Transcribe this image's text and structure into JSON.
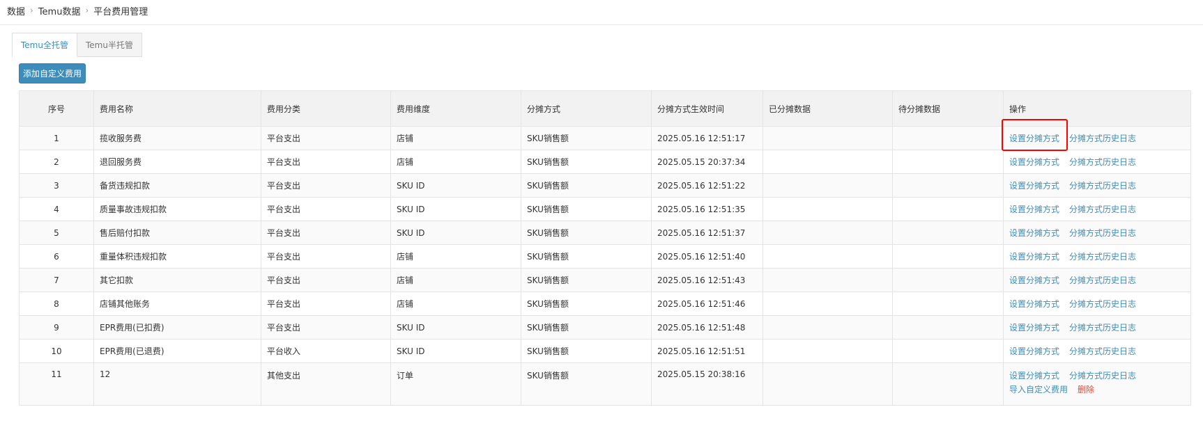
{
  "breadcrumb": [
    "数据",
    "Temu数据",
    "平台费用管理"
  ],
  "tabs": [
    {
      "label": "Temu全托管",
      "active": true
    },
    {
      "label": "Temu半托管",
      "active": false
    }
  ],
  "add_button": "添加自定义费用",
  "table": {
    "headers": [
      "序号",
      "费用名称",
      "费用分类",
      "费用维度",
      "分摊方式",
      "分摊方式生效时间",
      "已分摊数据",
      "待分摊数据",
      "操作"
    ],
    "actions": {
      "set_allocation": "设置分摊方式",
      "history": "分摊方式历史日志",
      "import": "导入自定义费用",
      "delete": "删除"
    },
    "rows": [
      [
        "1",
        "揽收服务费",
        "平台支出",
        "店铺",
        "SKU销售额",
        "2025.05.16 12:51:17",
        "",
        ""
      ],
      [
        "2",
        "退回服务费",
        "平台支出",
        "店铺",
        "SKU销售额",
        "2025.05.15 20:37:34",
        "",
        ""
      ],
      [
        "3",
        "备货违规扣款",
        "平台支出",
        "SKU ID",
        "SKU销售额",
        "2025.05.16 12:51:22",
        "",
        ""
      ],
      [
        "4",
        "质量事故违规扣款",
        "平台支出",
        "SKU ID",
        "SKU销售额",
        "2025.05.16 12:51:35",
        "",
        ""
      ],
      [
        "5",
        "售后赔付扣款",
        "平台支出",
        "SKU ID",
        "SKU销售额",
        "2025.05.16 12:51:37",
        "",
        ""
      ],
      [
        "6",
        "重量体积违规扣款",
        "平台支出",
        "店铺",
        "SKU销售额",
        "2025.05.16 12:51:40",
        "",
        ""
      ],
      [
        "7",
        "其它扣款",
        "平台支出",
        "店铺",
        "SKU销售额",
        "2025.05.16 12:51:43",
        "",
        ""
      ],
      [
        "8",
        "店铺其他账务",
        "平台支出",
        "店铺",
        "SKU销售额",
        "2025.05.16 12:51:46",
        "",
        ""
      ],
      [
        "9",
        "EPR费用(已扣费)",
        "平台支出",
        "SKU ID",
        "SKU销售额",
        "2025.05.16 12:51:48",
        "",
        ""
      ],
      [
        "10",
        "EPR费用(已退费)",
        "平台收入",
        "SKU ID",
        "SKU销售额",
        "2025.05.16 12:51:51",
        "",
        ""
      ],
      [
        "11",
        "12",
        "其他支出",
        "订单",
        "SKU销售额",
        "2025.05.15 20:38:16",
        "",
        ""
      ]
    ],
    "custom_row_index": 10
  },
  "colors": {
    "accent": "#3c8dbc",
    "delete": "#dd4b39",
    "highlight": "#ff0000"
  }
}
